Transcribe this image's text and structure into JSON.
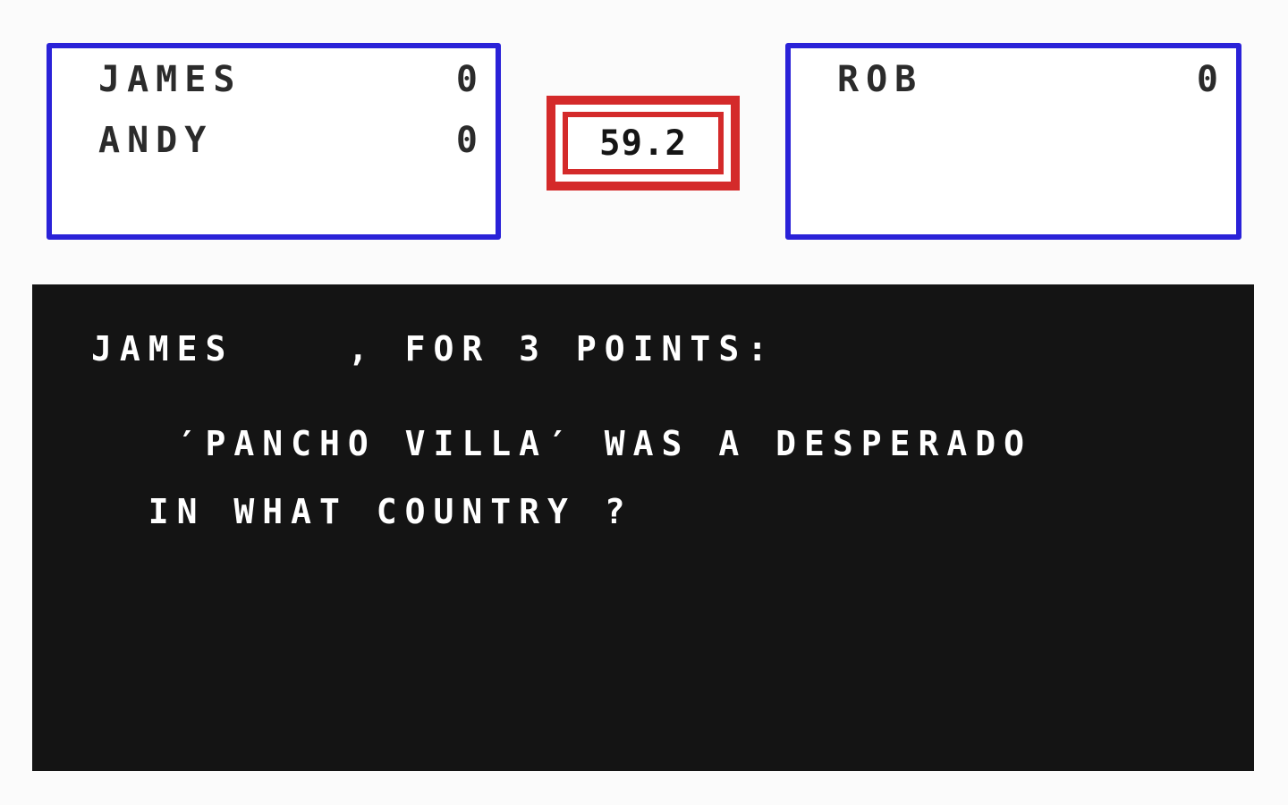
{
  "theme": {
    "page_background": "#fbfbfb",
    "panel_border": "#2a22d8",
    "panel_background": "#ffffff",
    "timer_accent": "#d42a2a",
    "question_background": "#141414",
    "question_text": "#ffffff",
    "score_text": "#2b2b2b"
  },
  "scoreboard": {
    "left_panel": {
      "players": [
        {
          "name": "JAMES",
          "score": "0"
        },
        {
          "name": "ANDY",
          "score": "0"
        }
      ]
    },
    "right_panel": {
      "players": [
        {
          "name": "ROB",
          "score": "0"
        }
      ]
    }
  },
  "timer": {
    "value": "59.2",
    "label": "countdown-timer"
  },
  "question": {
    "prompt": "JAMES    , FOR 3 POINTS:",
    "active_player": "JAMES",
    "points": "3",
    "lines": [
      "   ′PANCHO VILLA′ WAS A DESPERADO",
      "  IN WHAT COUNTRY ?"
    ]
  }
}
